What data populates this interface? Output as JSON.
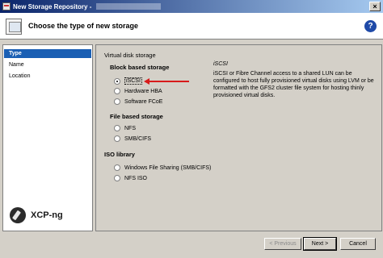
{
  "window": {
    "title": "New Storage Repository -"
  },
  "header": {
    "title": "Choose the type of new storage",
    "help": "?"
  },
  "sidebar": {
    "items": [
      {
        "label": "Type",
        "active": true
      },
      {
        "label": "Location",
        "active": false
      }
    ],
    "logo_text": "XCP-ng"
  },
  "sidebar_name": "Name",
  "content": {
    "virtual_disk_storage": "Virtual disk storage",
    "block_heading": "Block based storage",
    "block_options": [
      "iSCSI",
      "Hardware HBA",
      "Software FCoE"
    ],
    "file_heading": "File based storage",
    "file_options": [
      "NFS",
      "SMB/CIFS"
    ],
    "iso_heading": "ISO library",
    "iso_options": [
      "Windows File Sharing (SMB/CIFS)",
      "NFS ISO"
    ],
    "selected": "iSCSI",
    "description_title": "iSCSI",
    "description": "iSCSI or Fibre Channel access to a shared LUN can be configured to host fully provisioned virtual disks using LVM or be formatted with the GFS2 cluster file system for hosting thinly provisioned virtual disks."
  },
  "buttons": {
    "previous": "< Previous",
    "next": "Next >",
    "cancel": "Cancel"
  },
  "colors": {
    "selection": "#1a5fb4",
    "arrow": "#d81a1a",
    "titlebar": "#0a246a"
  }
}
